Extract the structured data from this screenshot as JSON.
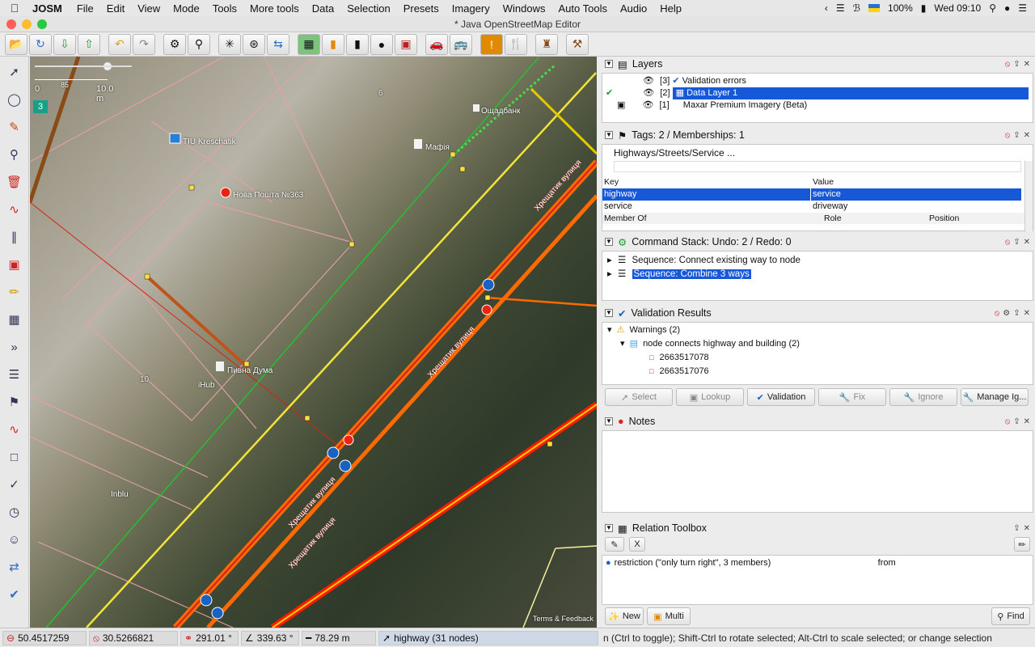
{
  "menubar": {
    "app_name": "JOSM",
    "items": [
      "File",
      "Edit",
      "View",
      "Mode",
      "Tools",
      "More tools",
      "Data",
      "Selection",
      "Presets",
      "Imagery",
      "Windows",
      "Auto Tools",
      "Audio",
      "Help"
    ],
    "battery": "100%",
    "clock": "Wed 09:10"
  },
  "window": {
    "title": "* Java OpenStreetMap Editor"
  },
  "map": {
    "zoom_level": "3",
    "scale": {
      "zero": "0",
      "mid": "85",
      "end": "10.0 m"
    },
    "labels": {
      "tiu": "TIU Kreschatik",
      "nova": "Нова Пошта №363",
      "mafia": "Мафія",
      "oschad": "Ощадбанк",
      "pyvna": "Пивна Дума",
      "ihub": "iHub",
      "inblu": "Inblu",
      "num6": "6",
      "num10": "10",
      "street1": "Хрещатик вулиця",
      "street2": "Хрещатик вулиця",
      "street3": "Хрещатик вулиця",
      "street4": "Хрещатик вулиця",
      "terms": "Terms & Feedback"
    }
  },
  "layers": {
    "title": "Layers",
    "items": [
      {
        "index": "[3]",
        "name": "Validation errors"
      },
      {
        "index": "[2]",
        "name": "Data Layer 1"
      },
      {
        "index": "[1]",
        "name": "Maxar Premium Imagery (Beta)"
      }
    ]
  },
  "tags": {
    "title": "Tags: 2 / Memberships: 1",
    "preset": "Highways/Streets/Service ...",
    "col_key": "Key",
    "col_value": "Value",
    "rows": [
      {
        "key": "highway",
        "value": "service"
      },
      {
        "key": "service",
        "value": "driveway"
      }
    ],
    "member_of": "Member Of",
    "role": "Role",
    "position": "Position"
  },
  "command_stack": {
    "title": "Command Stack: Undo: 2 / Redo: 0",
    "items": [
      "Sequence: Connect existing way to node",
      "Sequence: Combine 3 ways"
    ]
  },
  "validation": {
    "title": "Validation Results",
    "warnings": "Warnings (2)",
    "group": "node connects highway and building (2)",
    "nodes": [
      "2663517078",
      "2663517076"
    ],
    "buttons": [
      "Select",
      "Lookup",
      "Validation",
      "Fix",
      "Ignore",
      "Manage Ig..."
    ]
  },
  "notes": {
    "title": "Notes"
  },
  "relation_toolbox": {
    "title": "Relation Toolbox",
    "clear_label": "X",
    "relation": "restriction (\"only turn right\", 3 members)",
    "role": "from",
    "buttons": {
      "new": "New",
      "multi": "Multi",
      "find": "Find"
    }
  },
  "status": {
    "lat": "50.4517259",
    "lon": "30.5266821",
    "heading": "291.01 °",
    "angle": "339.63 °",
    "distance": "78.29 m",
    "selection": "highway (31 nodes)",
    "help": "n (Ctrl to toggle); Shift-Ctrl to rotate selected; Alt-Ctrl to scale selected; or change selection"
  }
}
